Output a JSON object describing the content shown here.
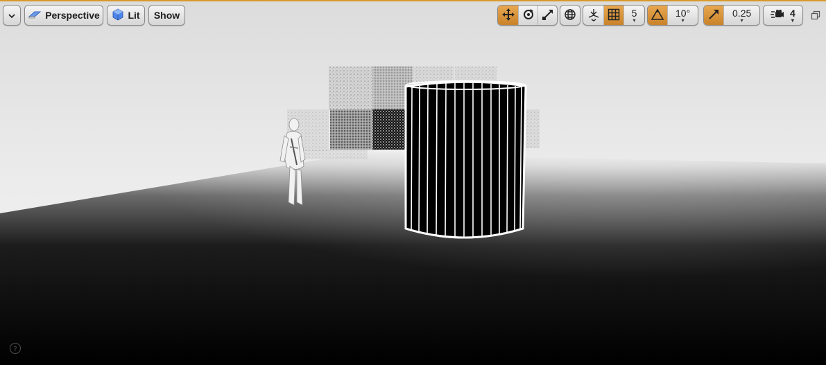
{
  "viewport": {
    "menu_icon": "chevron-down-icon",
    "view_mode": {
      "icon": "eraser-camera-icon",
      "label": "Perspective"
    },
    "lighting": {
      "icon": "lit-cube-icon",
      "label": "Lit"
    },
    "show_label": "Show",
    "transform": {
      "translate_icon": "move-arrows-icon",
      "rotate_icon": "rotate-icon",
      "scale_icon": "scale-arrows-icon",
      "active": "translate"
    },
    "coordinate_space_icon": "globe-icon",
    "surface_snap_icon": "surface-snap-icon",
    "grid_snap": {
      "icon": "grid-icon",
      "value": "5",
      "enabled": true
    },
    "rotation_snap": {
      "icon": "triangle-angle-icon",
      "value": "10°",
      "enabled": true
    },
    "scale_snap": {
      "icon": "scale-snap-icon",
      "value": "0.25",
      "enabled": true
    },
    "camera_speed": {
      "icon": "camera-speed-icon",
      "value": "4"
    },
    "restore_icon": "restore-window-icon",
    "help_icon": "help-circle-icon",
    "colors": {
      "accent": "#d99a2b",
      "toolbar": "#e6e6e6"
    }
  }
}
